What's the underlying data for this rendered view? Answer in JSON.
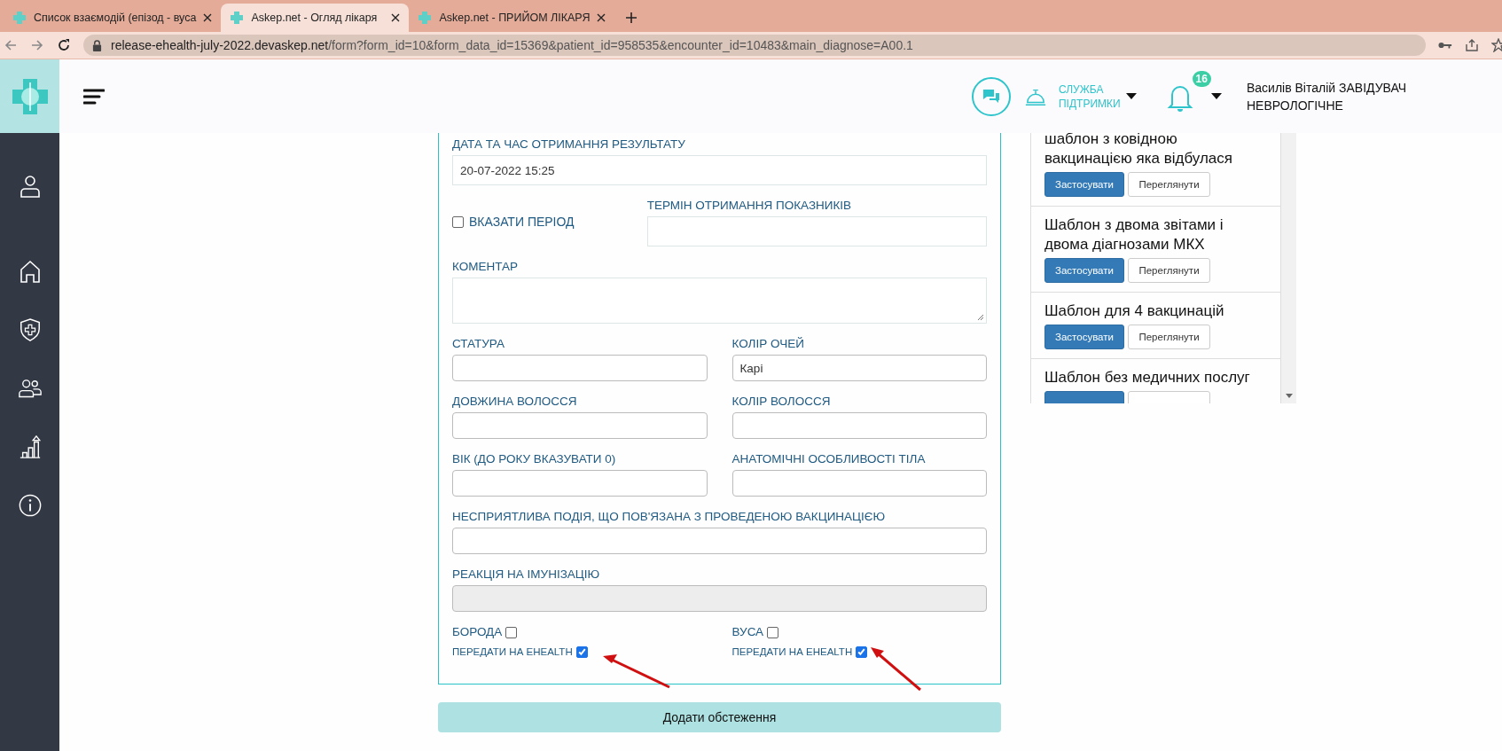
{
  "browser": {
    "tabs": [
      {
        "title": "Список взаємодій (епізод - вуса",
        "selected": false
      },
      {
        "title": "Askep.net - Огляд лікаря",
        "selected": true
      },
      {
        "title": "Askep.net - ПРИЙОМ ЛІКАРЯ",
        "selected": false
      }
    ],
    "url_host": "release-ehealth-july-2022.devaskep.net",
    "url_path": "/form?form_id=10&form_data_id=15369&patient_id=958535&encounter_id=10483&main_diagnose=A00.1"
  },
  "header": {
    "support_label": "СЛУЖБА ПІДТРИМКИ",
    "notification_count": "16",
    "user_name": "Василів Віталій ЗАВІДУВАЧ",
    "user_department": "НЕВРОЛОГІЧНЕ"
  },
  "form": {
    "rows": [
      [
        {
          "kind": "text",
          "label": "ДАТА ТА ЧАС ОТРИМАННЯ РЕЗУЛЬТАТУ",
          "value": "20-07-2022 15:25",
          "disabled": false
        }
      ],
      [
        {
          "kind": "checkbox",
          "label": "ВКАЗАТИ ПЕРІОД",
          "checked": false
        },
        {
          "kind": "text",
          "label": "ТЕРМІН ОТРИМАННЯ ПОКАЗНИКІВ",
          "disabled": false
        }
      ],
      [
        {
          "kind": "textarea",
          "label": "КОМЕНТАР",
          "disabled": false
        }
      ],
      [
        {
          "kind": "text",
          "label": "СТАТУРА",
          "disabled": false
        },
        {
          "kind": "text",
          "label": "КОЛІР ОЧЕЙ",
          "value": "Карі",
          "disabled": false
        }
      ],
      [
        {
          "kind": "text",
          "label": "ДОВЖИНА ВОЛОССЯ",
          "disabled": false
        },
        {
          "kind": "text",
          "label": "КОЛІР ВОЛОССЯ",
          "disabled": false
        }
      ],
      [
        {
          "kind": "text",
          "label": "ВІК (ДО РОКУ ВКАЗУВАТИ 0)",
          "disabled": false
        },
        {
          "kind": "text",
          "label": "АНАТОМІЧНІ ОСОБЛИВОСТІ ТІЛА",
          "disabled": false
        }
      ],
      [
        {
          "kind": "text",
          "label": "НЕСПРИЯТЛИВА ПОДІЯ, ЩО ПОВ'ЯЗАНА З ПРОВЕДЕНОЮ ВАКЦИНАЦІЄЮ",
          "disabled": false
        }
      ],
      [
        {
          "kind": "text",
          "label": "РЕАКЦІЯ НА ІМУНІЗАЦІЮ",
          "disabled": true
        }
      ],
      [
        {
          "kind": "flag",
          "label": "БОРОДА",
          "checked": false,
          "ehealth_label": "ПЕРЕДАТИ НА EHEALTH",
          "ehealth_checked": true
        },
        {
          "kind": "flag",
          "label": "ВУСА",
          "checked": false,
          "ehealth_label": "ПЕРЕДАТИ НА EHEALTH",
          "ehealth_checked": true
        }
      ]
    ],
    "submit": "Додати обстеження"
  },
  "templates": [
    {
      "title": "шаблон з ковідною вакцинацією яка відбулася",
      "apply": "Застосувати",
      "view": "Переглянути"
    },
    {
      "title": "Шаблон з двома звітами і двома діагнозами МКХ",
      "apply": "Застосувати",
      "view": "Переглянути"
    },
    {
      "title": "Шаблон для 4 вакцинацій",
      "apply": "Застосувати",
      "view": "Переглянути"
    },
    {
      "title": "Шаблон без медичних послуг"
    }
  ]
}
